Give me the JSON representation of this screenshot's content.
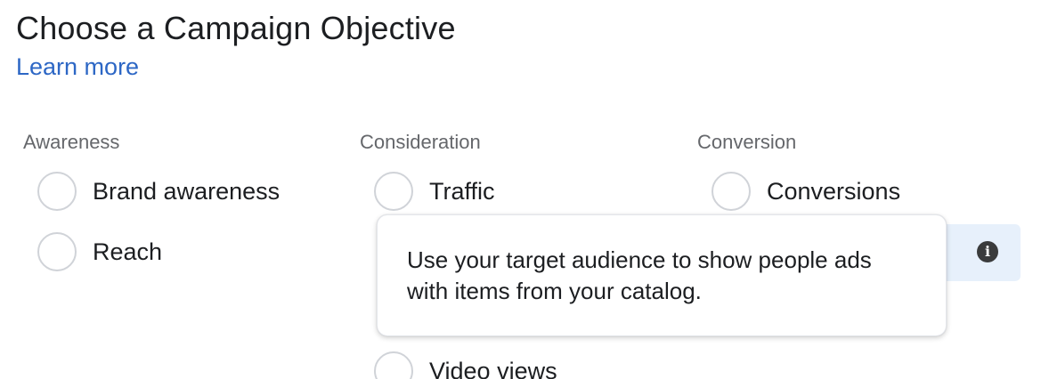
{
  "header": {
    "title": "Choose a Campaign Objective",
    "learn_more": "Learn more"
  },
  "columns": [
    {
      "heading": "Awareness",
      "options": [
        {
          "label": "Brand awareness",
          "selected": false
        },
        {
          "label": "Reach",
          "selected": false
        }
      ]
    },
    {
      "heading": "Consideration",
      "options": [
        {
          "label": "Traffic",
          "selected": false
        },
        {
          "label": "Video views",
          "selected": false
        }
      ]
    },
    {
      "heading": "Conversion",
      "options": [
        {
          "label": "Conversions",
          "selected": false
        }
      ]
    }
  ],
  "tooltip": {
    "text": "Use your target audience to show people ads with items from your catalog."
  },
  "icons": {
    "info": "info-icon"
  },
  "colors": {
    "link": "#2d67c5",
    "highlight": "#e7f0fb",
    "muted_heading": "#65676b",
    "radio_border": "#d0d3d8"
  }
}
